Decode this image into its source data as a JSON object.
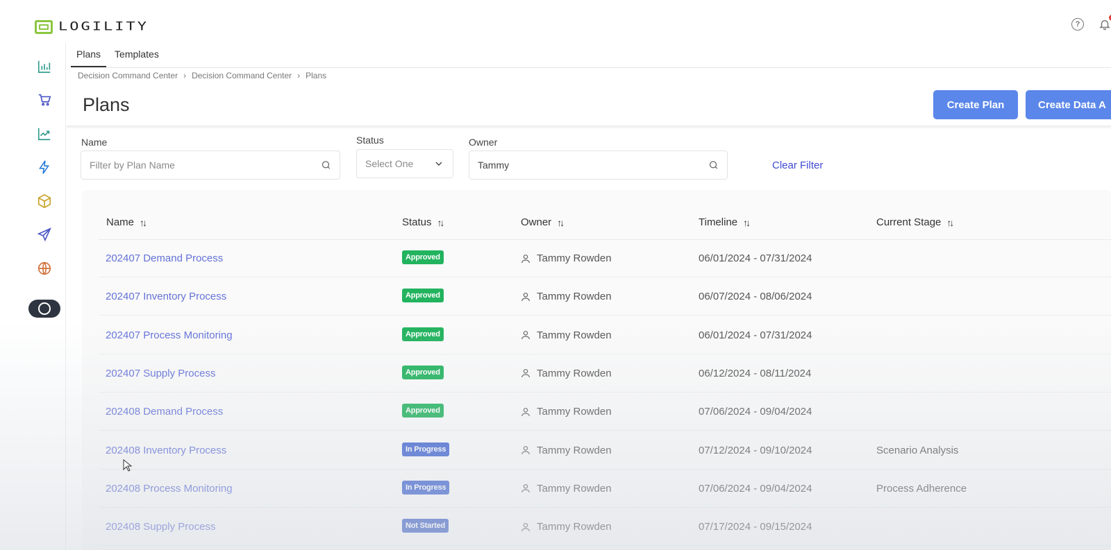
{
  "app": {
    "logo_text": "LOGILITY"
  },
  "colors": {
    "primary": "#5b87ea",
    "link": "#6472d8",
    "approved": "#22b35e",
    "in_progress": "#3f63d0",
    "not_started": "#3d5fc7",
    "clear_filter": "#3f4bd1"
  },
  "topbar": {
    "icons": [
      "help-icon",
      "bell-icon"
    ]
  },
  "sidebar": {
    "items": [
      "bar-chart-icon",
      "cart-icon",
      "trend-chart-icon",
      "lightning-icon",
      "cube-icon",
      "send-icon",
      "globe-icon"
    ],
    "toggle": "theme-toggle-icon"
  },
  "tabs": [
    {
      "label": "Plans",
      "active": true
    },
    {
      "label": "Templates",
      "active": false
    }
  ],
  "breadcrumb": [
    "Decision Command Center",
    "Decision Command Center",
    "Plans"
  ],
  "page": {
    "title": "Plans"
  },
  "actions": {
    "create_plan": "Create Plan",
    "create_data": "Create Data A"
  },
  "filters": {
    "name_label": "Name",
    "name_placeholder": "Filter by Plan Name",
    "status_label": "Status",
    "status_value": "Select One",
    "owner_label": "Owner",
    "owner_value": "Tammy",
    "clear": "Clear Filter"
  },
  "table": {
    "columns": [
      "Name",
      "Status",
      "Owner",
      "Timeline",
      "Current Stage"
    ],
    "rows": [
      {
        "name": "202407 Demand Process",
        "status": "Approved",
        "owner": "Tammy Rowden",
        "timeline": "06/01/2024 - 07/31/2024",
        "stage": ""
      },
      {
        "name": "202407 Inventory Process",
        "status": "Approved",
        "owner": "Tammy Rowden",
        "timeline": "06/07/2024 - 08/06/2024",
        "stage": ""
      },
      {
        "name": "202407 Process Monitoring",
        "status": "Approved",
        "owner": "Tammy Rowden",
        "timeline": "06/01/2024 - 07/31/2024",
        "stage": ""
      },
      {
        "name": "202407 Supply Process",
        "status": "Approved",
        "owner": "Tammy Rowden",
        "timeline": "06/12/2024 - 08/11/2024",
        "stage": ""
      },
      {
        "name": "202408 Demand Process",
        "status": "Approved",
        "owner": "Tammy Rowden",
        "timeline": "07/06/2024 - 09/04/2024",
        "stage": ""
      },
      {
        "name": "202408 Inventory Process",
        "status": "In Progress",
        "owner": "Tammy Rowden",
        "timeline": "07/12/2024 - 09/10/2024",
        "stage": "Scenario Analysis"
      },
      {
        "name": "202408 Process Monitoring",
        "status": "In Progress",
        "owner": "Tammy Rowden",
        "timeline": "07/06/2024 - 09/04/2024",
        "stage": "Process Adherence"
      },
      {
        "name": "202408 Supply Process",
        "status": "Not Started",
        "owner": "Tammy Rowden",
        "timeline": "07/17/2024 - 09/15/2024",
        "stage": ""
      }
    ]
  }
}
